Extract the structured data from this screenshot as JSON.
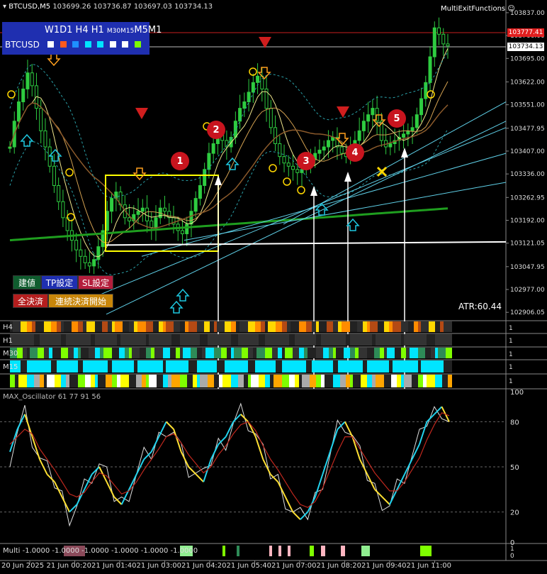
{
  "header": {
    "symbol_tf": "BTCUSD,M5",
    "ohlc": "103699.26 103736.87 103697.03 103734.13",
    "indicator_name": "MultiExitFunctions"
  },
  "tf_panel": {
    "labels": [
      "W1",
      "D1",
      "H4",
      "H1",
      "M30",
      "M15",
      "M5",
      "M1"
    ],
    "symbol": "BTCUSD",
    "squares": [
      "#ffffff",
      "#ff5a1e",
      "#1e90ff",
      "#00e5ff",
      "#00e5ff",
      "#ffffff",
      "#ffffff",
      "#7cfc00"
    ]
  },
  "buttons": {
    "tatene": "建値",
    "tp": "TP設定",
    "sl": "SL設定",
    "close_all": "全決済",
    "cont_close": "連続決済開始"
  },
  "price_tags": {
    "red": "103777.41",
    "current": "103734.13"
  },
  "atr": "ATR:60.44",
  "strips": [
    "H4",
    "H1",
    "M30",
    "M15",
    "1"
  ],
  "oscillator": {
    "title": "MAX_Oscillator 61 77 91 56",
    "levels": [
      "100",
      "80",
      "50",
      "20",
      "0"
    ]
  },
  "multi": {
    "label": "Multi -1.0000 -1.0000 -1.0000 -1.0000 -1.0000 -1.0000",
    "axis": [
      "1",
      "0"
    ]
  },
  "badges": [
    "1",
    "2",
    "3",
    "4",
    "5"
  ],
  "chart_data": [
    {
      "type": "candlestick",
      "title": "BTCUSD,M5",
      "y_ticks": [
        103837.0,
        103766.0,
        103695.0,
        103622.0,
        103551.0,
        103477.95,
        103407.0,
        103336.0,
        103262.95,
        103192.0,
        103121.05,
        103047.95,
        102977.0,
        102906.05
      ],
      "ylim": [
        102880,
        103850
      ],
      "x_ticks": [
        "20 Jun 2025",
        "21 Jun 00:20",
        "21 Jun 01:40",
        "21 Jun 03:00",
        "21 Jun 04:20",
        "21 Jun 05:40",
        "21 Jun 07:00",
        "21 Jun 08:20",
        "21 Jun 09:40",
        "21 Jun 11:00"
      ],
      "close_series": [
        103420,
        103500,
        103560,
        103600,
        103650,
        103610,
        103540,
        103470,
        103420,
        103360,
        103300,
        103250,
        103200,
        103160,
        103130,
        103100,
        103080,
        103060,
        103050,
        103070,
        103110,
        103160,
        103220,
        103260,
        103280,
        103240,
        103200,
        103190,
        103210,
        103220,
        103230,
        103190,
        103170,
        103200,
        103230,
        103220,
        103200,
        103180,
        103160,
        103150,
        103180,
        103220,
        103260,
        103300,
        103350,
        103400,
        103430,
        103460,
        103440,
        103420,
        103450,
        103500,
        103540,
        103560,
        103590,
        103620,
        103640,
        103600,
        103540,
        103480,
        103430,
        103390,
        103370,
        103360,
        103350,
        103340,
        103350,
        103360,
        103380,
        103400,
        103410,
        103420,
        103440,
        103450,
        103420,
        103400,
        103390,
        103410,
        103440,
        103470,
        103500,
        103520,
        103540,
        103500,
        103440,
        103420,
        103430,
        103440,
        103450,
        103460,
        103470,
        103480,
        103520,
        103570,
        103620,
        103700,
        103790,
        103770,
        103740,
        103734
      ],
      "signals": [
        {
          "label": "1",
          "price": 103400
        },
        {
          "label": "2",
          "price": 103470
        },
        {
          "label": "3",
          "price": 103360
        },
        {
          "label": "4",
          "price": 103420
        },
        {
          "label": "5",
          "price": 103500
        }
      ],
      "atr": 60.44
    },
    {
      "type": "line",
      "title": "MAX_Oscillator 61 77 91 56",
      "y_ticks": [
        100,
        80,
        50,
        20,
        0
      ],
      "ylim": [
        0,
        100
      ],
      "series": [
        {
          "name": "fast",
          "values": [
            60,
            75,
            85,
            70,
            55,
            45,
            40,
            30,
            20,
            25,
            35,
            45,
            50,
            40,
            30,
            25,
            35,
            45,
            55,
            60,
            70,
            80,
            75,
            60,
            50,
            45,
            40,
            55,
            65,
            70,
            80,
            85,
            80,
            70,
            55,
            45,
            40,
            30,
            20,
            15,
            20,
            30,
            45,
            60,
            75,
            80,
            70,
            55,
            45,
            35,
            30,
            25,
            35,
            45,
            55,
            65,
            80,
            85,
            90,
            80
          ]
        },
        {
          "name": "signal",
          "values": [
            65,
            70,
            75,
            72,
            62,
            55,
            48,
            40,
            32,
            30,
            33,
            40,
            46,
            44,
            38,
            32,
            34,
            40,
            48,
            55,
            62,
            70,
            72,
            66,
            58,
            52,
            46,
            50,
            58,
            64,
            72,
            78,
            80,
            74,
            64,
            55,
            48,
            40,
            32,
            25,
            23,
            27,
            36,
            48,
            60,
            70,
            70,
            62,
            54,
            46,
            40,
            34,
            34,
            40,
            48,
            56,
            68,
            78,
            86,
            84
          ]
        }
      ]
    }
  ]
}
